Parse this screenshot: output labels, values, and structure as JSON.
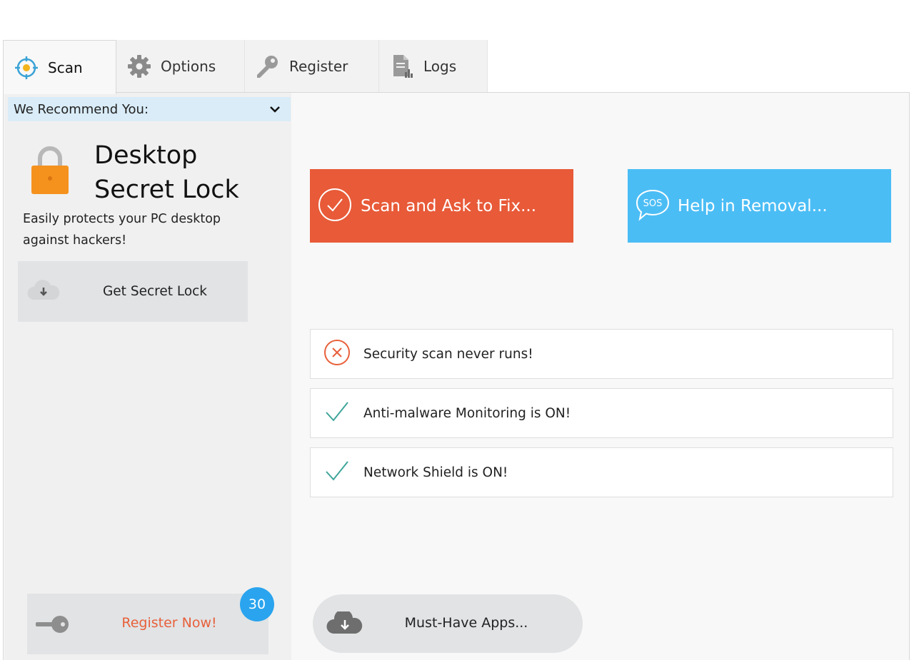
{
  "tabs": [
    {
      "label": "Scan",
      "icon": "crosshair-icon",
      "active": true
    },
    {
      "label": "Options",
      "icon": "gear-icon",
      "active": false
    },
    {
      "label": "Register",
      "icon": "key-icon",
      "active": false
    },
    {
      "label": "Logs",
      "icon": "document-chart-icon",
      "active": false
    }
  ],
  "sidebar": {
    "recommend_header": "We Recommend You:",
    "product": {
      "title_line1": "Desktop",
      "title_line2": "Secret Lock",
      "description": "Easily protects your PC desktop against hackers!",
      "button_label": "Get Secret Lock"
    },
    "register": {
      "button_label": "Register Now!",
      "badge_count": "30"
    }
  },
  "main": {
    "scan_button_label": "Scan and Ask to Fix...",
    "help_button_label": "Help in Removal...",
    "status_items": [
      {
        "text": "Security scan never runs!",
        "state": "error"
      },
      {
        "text": "Anti-malware Monitoring is ON!",
        "state": "ok"
      },
      {
        "text": "Network Shield is ON!",
        "state": "ok"
      }
    ],
    "apps_button_label": "Must-Have Apps..."
  },
  "colors": {
    "scan_button": "#e85a38",
    "help_button": "#4bbdf5",
    "register_text": "#e8603a",
    "badge": "#2aa4ee",
    "check": "#3fa59a",
    "error": "#e8603a",
    "lock": "#f5921e",
    "recommend_header_bg": "#d9ecf8"
  }
}
